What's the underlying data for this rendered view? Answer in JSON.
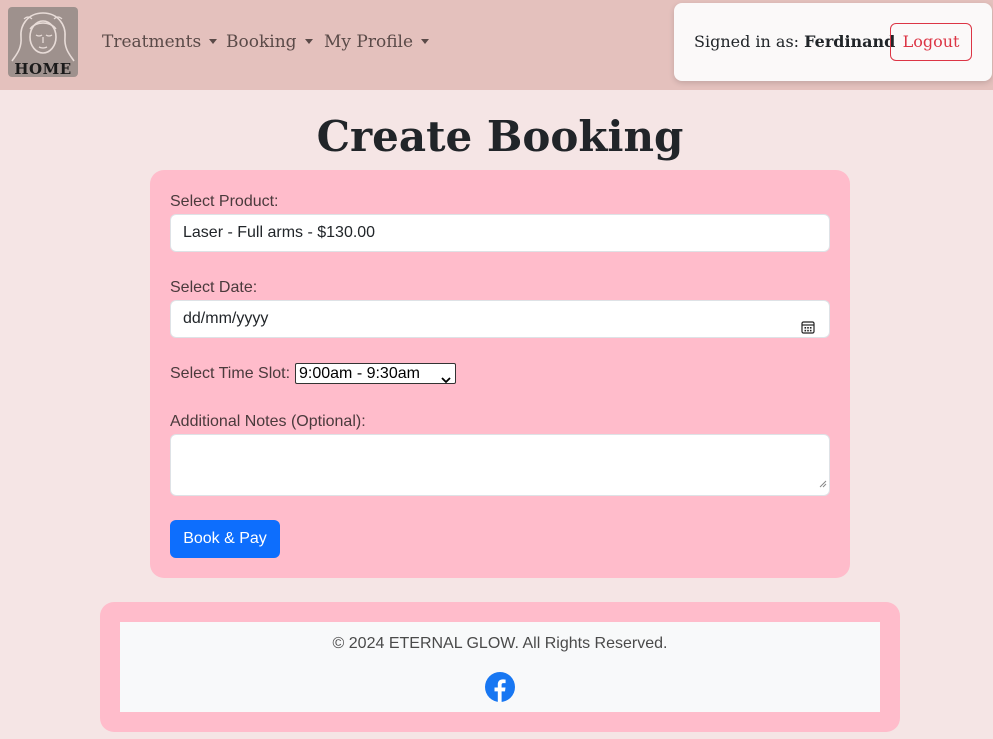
{
  "nav": {
    "logo_text": "HOME",
    "items": [
      {
        "label": "Treatments"
      },
      {
        "label": "Booking"
      },
      {
        "label": "My Profile"
      }
    ]
  },
  "user": {
    "signed_in_prefix": "Signed in as:",
    "name": "Ferdinand",
    "logout_label": "Logout"
  },
  "page": {
    "title": "Create Booking"
  },
  "form": {
    "product_label": "Select Product:",
    "product_value": "Laser - Full arms - $130.00",
    "date_label": "Select Date:",
    "date_placeholder": "dd/mm/yyyy",
    "time_label": "Select Time Slot:",
    "time_value": "9:00am - 9:30am",
    "notes_label": "Additional Notes (Optional):",
    "submit_label": "Book & Pay"
  },
  "footer": {
    "copyright": "© 2024 ETERNAL GLOW. All Rights Reserved."
  },
  "icons": {
    "logo": "woman-face-logo-icon",
    "calendar": "calendar-icon",
    "facebook": "facebook-icon"
  },
  "colors": {
    "navbar_bg": "#e4c1bd",
    "page_bg": "#f5e5e5",
    "card_bg": "#ffbccb",
    "primary": "#0d6efd",
    "danger": "#dc3545",
    "facebook": "#1877f2"
  }
}
